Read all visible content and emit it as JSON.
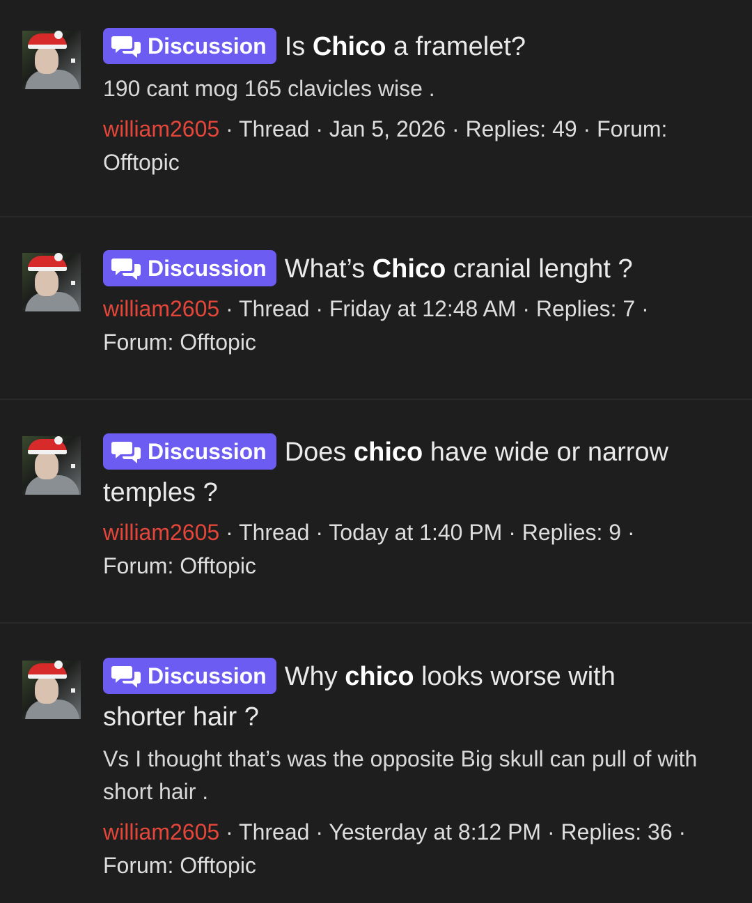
{
  "threads": [
    {
      "prefix": "Discussion",
      "title_pre": "Is ",
      "title_bold": "Chico",
      "title_post": " a framelet?",
      "snippet": "190 cant mog 165 clavicles wise .",
      "author": "william2605",
      "meta_rest": " · Thread · Jan 5, 2026 · Replies: 49 · Forum: Offtopic"
    },
    {
      "prefix": "Discussion",
      "title_pre": "What’s ",
      "title_bold": "Chico",
      "title_post": " cranial lenght ?",
      "snippet": "",
      "author": "william2605",
      "meta_rest": " · Thread · Friday at 12:48 AM · Replies: 7 · Forum: Offtopic"
    },
    {
      "prefix": "Discussion",
      "title_pre": "Does ",
      "title_bold": "chico",
      "title_post": " have wide or narrow temples ?",
      "snippet": "",
      "author": "william2605",
      "meta_rest": " · Thread · Today at 1:40 PM · Replies: 9 · Forum: Offtopic"
    },
    {
      "prefix": "Discussion",
      "title_pre": "Why ",
      "title_bold": "chico",
      "title_post": " looks worse with shorter hair ?",
      "snippet": "Vs I thought that’s was the opposite Big skull can pull of with short hair .",
      "author": "william2605",
      "meta_rest": " · Thread · Yesterday at 8:12 PM · Replies: 36 · Forum: Offtopic"
    }
  ],
  "colors": {
    "background": "#1e1e1f",
    "badge": "#6d5cf2",
    "author": "#e5463a"
  }
}
